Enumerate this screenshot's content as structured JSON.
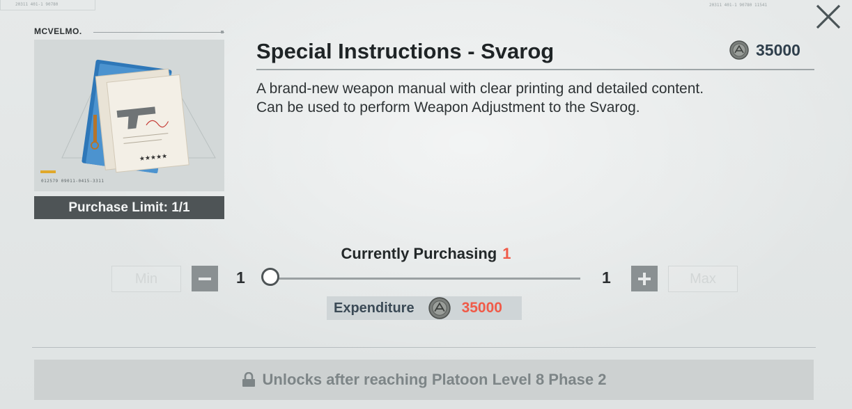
{
  "brand": "MCVELMO.",
  "item": {
    "title": "Special Instructions - Svarog",
    "price": "35000",
    "description_line1": "A brand-new weapon manual with clear printing and detailed content.",
    "description_line2": "Can be used to perform Weapon Adjustment to the Svarog.",
    "purchase_limit": "Purchase Limit: 1/1",
    "art_code": "012579  09011-0415-3311"
  },
  "purchase": {
    "label": "Currently Purchasing",
    "count": "1",
    "min_label": "Min",
    "max_label": "Max",
    "slider_min": "1",
    "slider_max": "1",
    "slider_value_fraction": 0,
    "expenditure_label": "Expenditure",
    "expenditure_value": "35000"
  },
  "unlock": {
    "message": "Unlocks after reaching Platoon Level 8 Phase 2"
  },
  "decor": {
    "top_codes_left": "20311   401-1   90780",
    "top_codes_right": "20311   401-1   90780   11541"
  },
  "colors": {
    "accent_red": "#f05a48",
    "price_blue": "#2f3f4c",
    "limit_bg": "#4e5456",
    "locked_bg": "#cdd1d1"
  },
  "icons": {
    "close": "close-icon",
    "currency": "coin-icon",
    "minus": "minus-icon",
    "plus": "plus-icon",
    "lock": "lock-icon"
  }
}
